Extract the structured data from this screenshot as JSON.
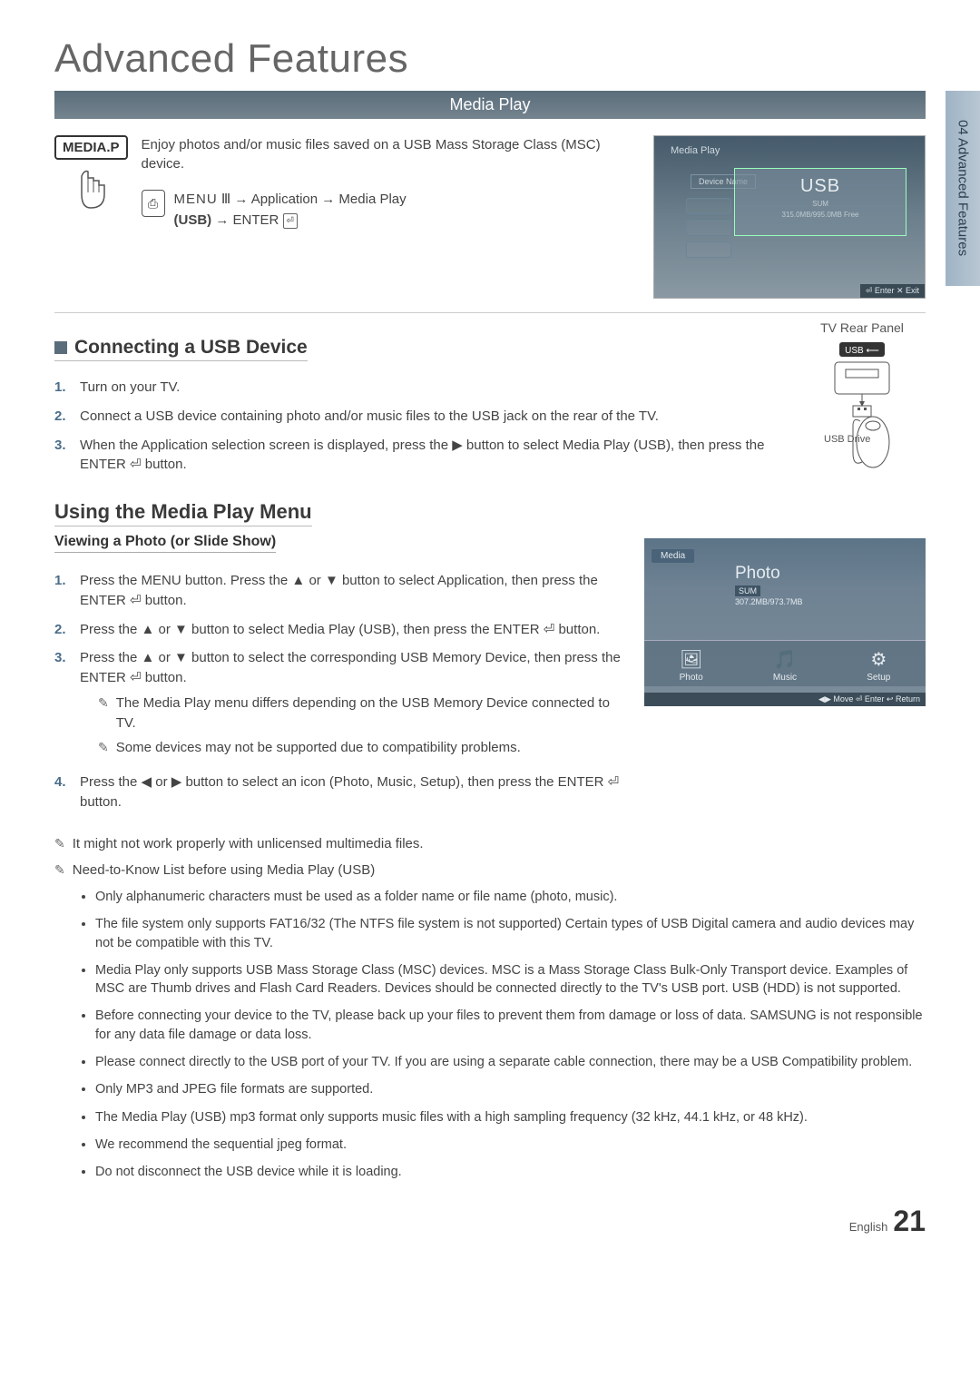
{
  "chapterTitle": "Advanced Features",
  "sideTab": "04   Advanced Features",
  "sectionBar": "Media Play",
  "remoteButton": "MEDIA.P",
  "introText": "Enjoy photos and/or music files saved on a USB Mass Storage Class (MSC) device.",
  "menuPath": {
    "line1a": "MENU",
    "line1b": "→ Application → Media Play",
    "line2a": "(USB)",
    "line2b": "→ ENTER"
  },
  "screenshot1": {
    "title": "Media Play",
    "deviceName": "Device Name",
    "usb": "USB",
    "sub1": "SUM",
    "sub2": "315.0MB/995.0MB Free",
    "footer": "⏎ Enter    ✕ Exit"
  },
  "connecting": {
    "heading": "Connecting a USB Device",
    "rearLabel": "TV Rear Panel",
    "usbPortLabel": "USB ⟵",
    "usbDriveLabel": "USB Drive",
    "steps": [
      "Turn on your TV.",
      "Connect a USB device containing photo and/or music files to the USB jack on the rear of the TV.",
      "When the Application selection screen is displayed, press the ▶ button to select Media Play (USB), then press the ENTER ⏎ button."
    ]
  },
  "usingHeading": "Using the Media Play Menu",
  "viewing": {
    "subHeading": "Viewing a Photo (or Slide Show)",
    "steps": [
      "Press the MENU button. Press the ▲ or ▼ button to select Application, then press the ENTER ⏎ button.",
      "Press the ▲ or ▼ button to select Media Play (USB), then press the ENTER ⏎ button.",
      "Press the ▲ or ▼ button to select the corresponding USB Memory Device, then press the ENTER ⏎ button.",
      "Press the ◀ or ▶ button to select an icon (Photo, Music, Setup), then press the ENTER ⏎ button."
    ],
    "subNotes": [
      "The Media Play menu differs depending on the USB Memory Device connected to TV.",
      "Some devices may not be supported due to compatibility problems."
    ]
  },
  "screenshot2": {
    "tab": "Media",
    "main": "Photo",
    "sum": "SUM",
    "size": "307.2MB/973.7MB",
    "icons": [
      "Photo",
      "Music",
      "Setup"
    ],
    "footer": "◀▶ Move    ⏎ Enter    ↩ Return"
  },
  "outerNotes": {
    "n1": "It might not work properly with unlicensed multimedia files.",
    "n2": "Need-to-Know List before using Media Play (USB)",
    "bullets": [
      "Only alphanumeric characters must be used as a folder name or file name (photo, music).",
      "The file system only supports FAT16/32 (The NTFS file system is not supported) Certain types of USB Digital camera and audio devices may not be compatible with this TV.",
      "Media Play only supports USB Mass Storage Class (MSC) devices. MSC is a Mass Storage Class Bulk-Only Transport device. Examples of MSC are Thumb drives and Flash Card Readers. Devices should be connected directly to the TV's USB port. USB (HDD) is not supported.",
      "Before connecting your device to the TV, please back up your files to prevent them from damage or loss of data. SAMSUNG is not responsible for any data file damage or data loss.",
      "Please connect directly to the USB port of your TV. If you are using a separate cable connection, there may be a USB Compatibility problem.",
      "Only MP3 and JPEG file formats are supported.",
      "The Media Play (USB) mp3 format only supports music files with a high sampling frequency (32 kHz, 44.1 kHz, or 48 kHz).",
      "We recommend the sequential jpeg format.",
      "Do not disconnect the USB device while it is loading."
    ]
  },
  "footer": {
    "lang": "English",
    "page": "21"
  }
}
